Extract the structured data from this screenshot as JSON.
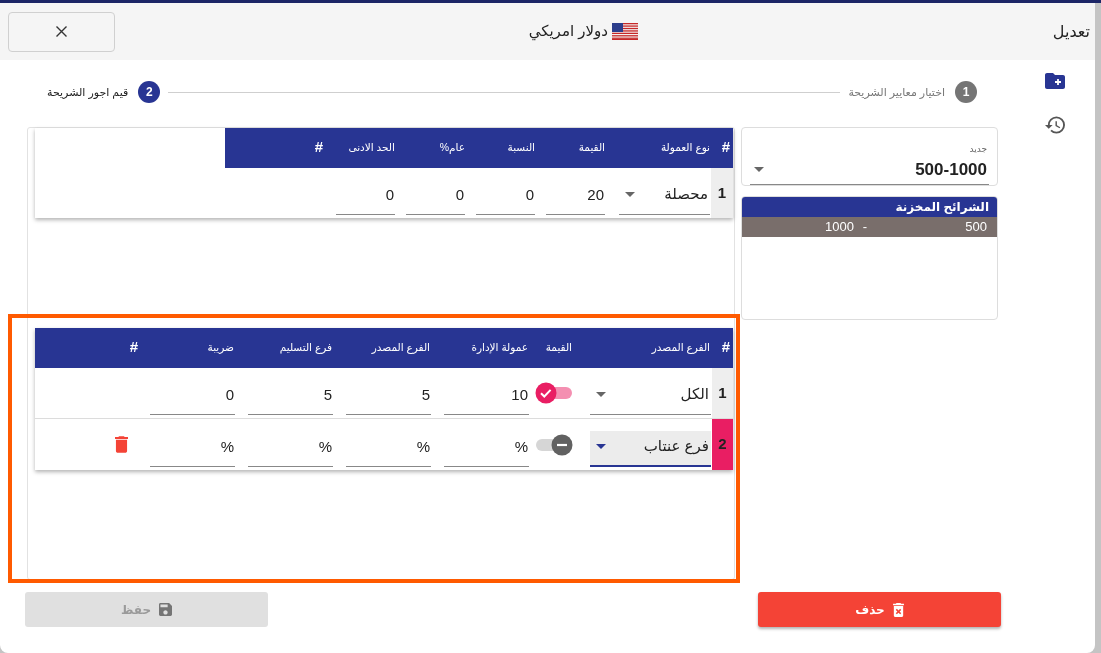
{
  "window": {
    "title": "تعديل",
    "heading": "دولار امريكي"
  },
  "steps": [
    {
      "number": "1",
      "label": "اختيار معايير الشريحة",
      "selected": false
    },
    {
      "number": "2",
      "label": "قيم اجور الشريحة",
      "selected": true
    }
  ],
  "range_select": {
    "label": "جديد",
    "value": "500-1000"
  },
  "stored_ranges": {
    "title": "الشرائح المخزنة",
    "rows": [
      {
        "from": "500",
        "separator": "-",
        "to": "1000",
        "selected": true
      }
    ]
  },
  "commission_table": {
    "columns": [
      "#",
      "نوع العمولة",
      "القيمة",
      "النسبة",
      "عام%",
      "الحد الادنى",
      "#"
    ],
    "rows": [
      {
        "number": "1",
        "selected": false,
        "type": "محصلة",
        "fields": [
          {
            "value": "20"
          },
          {
            "value": "0"
          },
          {
            "value": "0"
          },
          {
            "value": "0"
          }
        ]
      }
    ]
  },
  "branch_table": {
    "highlighted": true,
    "columns": [
      "#",
      "الفرع المصدر",
      "القيمة",
      "عمولة الإدارة",
      "الفرع المصدر",
      "فرع التسليم",
      "ضريبة",
      "#"
    ],
    "rows": [
      {
        "number": "1",
        "selected": false,
        "branch": "الكل",
        "on": true,
        "fields": [
          {
            "value": "10"
          },
          {
            "value": "5"
          },
          {
            "value": "5"
          },
          {
            "value": "0"
          }
        ],
        "deletable": false
      },
      {
        "number": "2",
        "selected": true,
        "branch": "فرع عنتاب",
        "on": false,
        "fields": [
          {
            "placeholder": "%"
          },
          {
            "placeholder": "%"
          },
          {
            "placeholder": "%"
          },
          {
            "placeholder": "%"
          }
        ],
        "deletable": true
      }
    ]
  },
  "buttons": [
    {
      "kind": "delete",
      "label": "حذف",
      "disabled": false
    },
    {
      "kind": "save",
      "label": "حفظ",
      "disabled": true
    }
  ]
}
